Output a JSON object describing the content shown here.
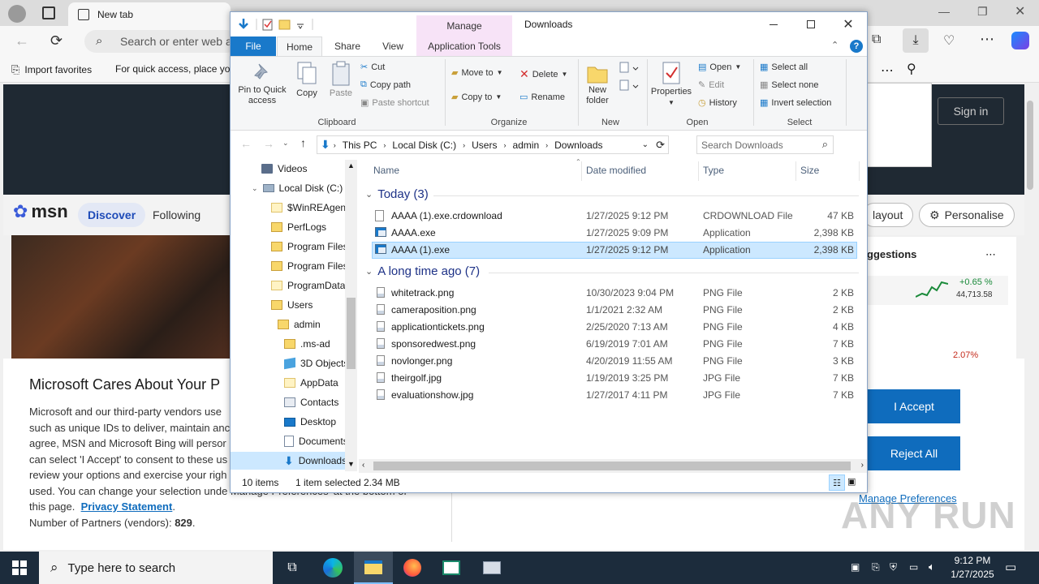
{
  "edge": {
    "tab_title": "New tab",
    "address_placeholder": "Search or enter web a",
    "favorites": [
      "Import favorites",
      "For quick access, place yo"
    ],
    "sign_in": "Sign in"
  },
  "msn": {
    "logo": "msn",
    "nav": [
      "Discover",
      "Following"
    ],
    "layout_btn": "layout",
    "personalise_btn": "Personalise",
    "suggestions": "ggestions",
    "stock_change": "+0.65 %",
    "stock_value": "44,713.58",
    "stock_red": "2.07%"
  },
  "consent": {
    "title": "Microsoft Cares About Your P",
    "body_lines": [
      "Microsoft and our third-party vendors use",
      "such as unique IDs to deliver, maintain anc",
      "agree, MSN and Microsoft Bing will persor",
      "can select 'I Accept' to consent to these us",
      "review your options and exercise your righ",
      "used. You can change your selection unde"
    ],
    "body_tail": "Manage Preferences' at the bottom of",
    "this_page": "this page.",
    "privacy_link": "Privacy Statement",
    "partners_label": "Number of Partners (vendors):",
    "partners_count": "829",
    "accept": "I Accept",
    "reject": "Reject All",
    "manage": "Manage Preferences"
  },
  "explorer": {
    "manage_tab": "Manage",
    "title": "Downloads",
    "tabs": [
      "File",
      "Home",
      "Share",
      "View",
      "Application Tools"
    ],
    "ribbon": {
      "clipboard": {
        "label": "Clipboard",
        "pin": "Pin to Quick access",
        "copy": "Copy",
        "paste": "Paste",
        "cut": "Cut",
        "copy_path": "Copy path",
        "paste_shortcut": "Paste shortcut"
      },
      "organize": {
        "label": "Organize",
        "move_to": "Move to",
        "copy_to": "Copy to",
        "delete": "Delete",
        "rename": "Rename"
      },
      "new": {
        "label": "New",
        "new_folder": "New folder"
      },
      "open": {
        "label": "Open",
        "properties": "Properties",
        "open": "Open",
        "edit": "Edit",
        "history": "History"
      },
      "select": {
        "label": "Select",
        "select_all": "Select all",
        "select_none": "Select none",
        "invert": "Invert selection"
      }
    },
    "breadcrumb": [
      "This PC",
      "Local Disk (C:)",
      "Users",
      "admin",
      "Downloads"
    ],
    "search_placeholder": "Search Downloads",
    "nav_tree": [
      {
        "label": "Videos",
        "icon": "videos-folder-icon"
      },
      {
        "label": "Local Disk (C:)",
        "icon": "drive-icon"
      },
      {
        "label": "$WinREAgent",
        "icon": "folder-icon"
      },
      {
        "label": "PerfLogs",
        "icon": "folder-icon"
      },
      {
        "label": "Program Files",
        "icon": "folder-icon"
      },
      {
        "label": "Program Files",
        "icon": "folder-icon"
      },
      {
        "label": "ProgramData",
        "icon": "folder-icon"
      },
      {
        "label": "Users",
        "icon": "folder-icon"
      },
      {
        "label": "admin",
        "icon": "folder-icon"
      },
      {
        "label": ".ms-ad",
        "icon": "folder-icon"
      },
      {
        "label": "3D Objects",
        "icon": "3d-objects-icon"
      },
      {
        "label": "AppData",
        "icon": "folder-icon"
      },
      {
        "label": "Contacts",
        "icon": "contacts-icon"
      },
      {
        "label": "Desktop",
        "icon": "desktop-icon"
      },
      {
        "label": "Documents",
        "icon": "documents-icon"
      },
      {
        "label": "Downloads",
        "icon": "downloads-icon"
      }
    ],
    "columns": [
      "Name",
      "Date modified",
      "Type",
      "Size"
    ],
    "groups": [
      {
        "title": "Today (3)",
        "files": [
          {
            "name": "AAAA (1).exe.crdownload",
            "date": "1/27/2025 9:12 PM",
            "type": "CRDOWNLOAD File",
            "size": "47 KB",
            "icon": "blank-file-icon",
            "selected": false
          },
          {
            "name": "AAAA.exe",
            "date": "1/27/2025 9:09 PM",
            "type": "Application",
            "size": "2,398 KB",
            "icon": "exe-icon",
            "selected": false
          },
          {
            "name": "AAAA (1).exe",
            "date": "1/27/2025 9:12 PM",
            "type": "Application",
            "size": "2,398 KB",
            "icon": "exe-icon",
            "selected": true
          }
        ]
      },
      {
        "title": "A long time ago (7)",
        "files": [
          {
            "name": "whitetrack.png",
            "date": "10/30/2023 9:04 PM",
            "type": "PNG File",
            "size": "2 KB",
            "icon": "image-file-icon",
            "selected": false
          },
          {
            "name": "cameraposition.png",
            "date": "1/1/2021 2:32 AM",
            "type": "PNG File",
            "size": "2 KB",
            "icon": "image-file-icon",
            "selected": false
          },
          {
            "name": "applicationtickets.png",
            "date": "2/25/2020 7:13 AM",
            "type": "PNG File",
            "size": "4 KB",
            "icon": "image-file-icon",
            "selected": false
          },
          {
            "name": "sponsoredwest.png",
            "date": "6/19/2019 7:01 AM",
            "type": "PNG File",
            "size": "7 KB",
            "icon": "image-file-icon",
            "selected": false
          },
          {
            "name": "novlonger.png",
            "date": "4/20/2019 11:55 AM",
            "type": "PNG File",
            "size": "3 KB",
            "icon": "image-file-icon",
            "selected": false
          },
          {
            "name": "theirgolf.jpg",
            "date": "1/19/2019 3:25 PM",
            "type": "JPG File",
            "size": "7 KB",
            "icon": "image-file-icon",
            "selected": false
          },
          {
            "name": "evaluationshow.jpg",
            "date": "1/27/2017 4:11 PM",
            "type": "JPG File",
            "size": "7 KB",
            "icon": "image-file-icon",
            "selected": false
          }
        ]
      }
    ],
    "status": {
      "items": "10 items",
      "selected": "1 item selected",
      "size": "2.34 MB"
    }
  },
  "taskbar": {
    "search_placeholder": "Type here to search",
    "time": "9:12 PM",
    "date": "1/27/2025"
  },
  "watermark": "ANY RUN",
  "colors": {
    "accent": "#1979ca",
    "manage_tab": "#f7e3f7",
    "selection": "#cce8ff",
    "msn_button": "#0f6cbd",
    "taskbar": "#1c2c3c"
  }
}
